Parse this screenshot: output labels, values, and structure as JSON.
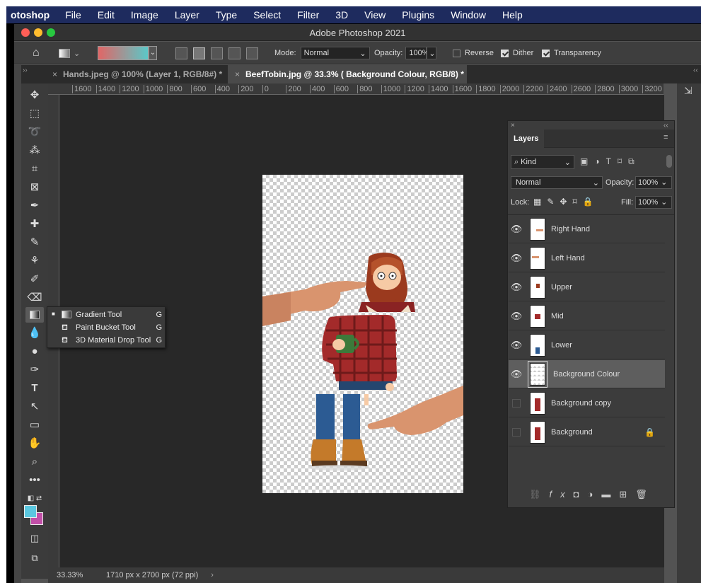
{
  "menubar": {
    "app_name": "otoshop",
    "items": [
      "File",
      "Edit",
      "Image",
      "Layer",
      "Type",
      "Select",
      "Filter",
      "3D",
      "View",
      "Plugins",
      "Window",
      "Help"
    ]
  },
  "window": {
    "title": "Adobe Photoshop 2021"
  },
  "options": {
    "mode_label": "Mode:",
    "mode_value": "Normal",
    "opacity_label": "Opacity:",
    "opacity_value": "100%",
    "reverse": {
      "label": "Reverse",
      "checked": false
    },
    "dither": {
      "label": "Dither",
      "checked": true
    },
    "transparency": {
      "label": "Transparency",
      "checked": true
    },
    "gradient_colors": [
      "#e06666",
      "#5bc8c8"
    ]
  },
  "tabs": [
    {
      "label": "Hands.jpeg @ 100% (Layer 1, RGB/8#) *",
      "active": false
    },
    {
      "label": "BeefTobin.jpg @ 33.3% ( Background Colour, RGB/8) *",
      "active": true
    }
  ],
  "ruler": {
    "h_ticks": [
      "1600",
      "1400",
      "1200",
      "1000",
      "800",
      "600",
      "400",
      "200",
      "0",
      "200",
      "400",
      "600",
      "800",
      "1000",
      "1200",
      "1400",
      "1600",
      "1800",
      "2000",
      "2200",
      "2400",
      "2600",
      "2800",
      "3000",
      "3200"
    ]
  },
  "tool_flyout": {
    "items": [
      {
        "label": "Gradient Tool",
        "key": "G",
        "active": true
      },
      {
        "label": "Paint Bucket Tool",
        "key": "G",
        "active": false
      },
      {
        "label": "3D Material Drop Tool",
        "key": "G",
        "active": false
      }
    ]
  },
  "colors": {
    "foreground": "#5bc8e0",
    "background": "#c24fa8"
  },
  "layers_panel": {
    "title": "Layers",
    "filter_label": "Kind",
    "blend_mode": "Normal",
    "opacity_label": "Opacity:",
    "opacity_value": "100%",
    "lock_label": "Lock:",
    "fill_label": "Fill:",
    "fill_value": "100%",
    "layers": [
      {
        "name": "Right Hand",
        "visible": true,
        "selected": false,
        "locked": false
      },
      {
        "name": "Left Hand",
        "visible": true,
        "selected": false,
        "locked": false
      },
      {
        "name": "Upper",
        "visible": true,
        "selected": false,
        "locked": false
      },
      {
        "name": "Mid",
        "visible": true,
        "selected": false,
        "locked": false
      },
      {
        "name": "Lower",
        "visible": true,
        "selected": false,
        "locked": false
      },
      {
        "name": "Background Colour",
        "visible": true,
        "selected": true,
        "locked": false
      },
      {
        "name": "Background copy",
        "visible": false,
        "selected": false,
        "locked": false
      },
      {
        "name": "Background",
        "visible": false,
        "selected": false,
        "locked": true
      }
    ]
  },
  "status": {
    "zoom": "33.33%",
    "doc_info": "1710 px x 2700 px (72 ppi)"
  }
}
